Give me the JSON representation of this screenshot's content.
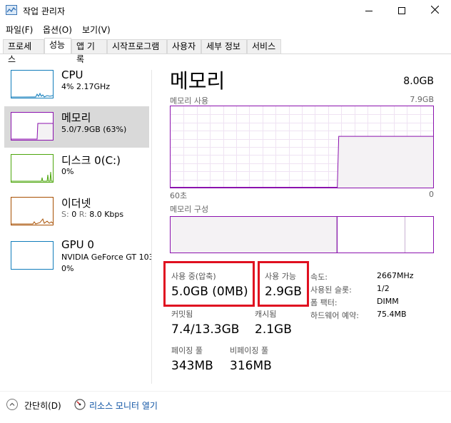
{
  "window": {
    "title": "작업 관리자",
    "minimize": "—",
    "maximize": "☐",
    "close": "✕"
  },
  "menu": [
    "파일(F)",
    "옵션(O)",
    "보기(V)"
  ],
  "tabs": [
    "프로세스",
    "성능",
    "앱 기록",
    "시작프로그램",
    "사용자",
    "세부 정보",
    "서비스"
  ],
  "active_tab": "성능",
  "sidebar": {
    "items": [
      {
        "title": "CPU",
        "subtitle": "4%  2.17GHz",
        "color": "#117dbb"
      },
      {
        "title": "메모리",
        "subtitle": "5.0/7.9GB (63%)",
        "color": "#8b12ae"
      },
      {
        "title": "디스크 0(C:)",
        "subtitle": "0%",
        "color": "#4da60c"
      },
      {
        "title": "이더넷",
        "subtitle_label_s": "S:",
        "subtitle_s": "0",
        "subtitle_label_r": "R:",
        "subtitle_r": "8.0 Kbps",
        "color": "#a74f01"
      },
      {
        "title": "GPU 0",
        "subtitle": "NVIDIA GeForce GT 103",
        "subtitle2": "0%",
        "color": "#117dbb"
      }
    ]
  },
  "main": {
    "title": "메모리",
    "total": "8.0GB",
    "usage_label": "메모리 사용",
    "usage_max": "7.9GB",
    "time_left": "60초",
    "time_right": "0",
    "composition_label": "메모리 구성",
    "usage_level_fraction": 0.63,
    "stats": {
      "in_use_label": "사용 중(압축)",
      "in_use_value": "5.0GB (0MB)",
      "available_label": "사용 가능",
      "available_value": "2.9GB",
      "committed_label": "커밋됨",
      "committed_value": "7.4/13.3GB",
      "cached_label": "캐시됨",
      "cached_value": "2.1GB",
      "paged_label": "페이징 풀",
      "paged_value": "343MB",
      "nonpaged_label": "비페이징 풀",
      "nonpaged_value": "316MB"
    },
    "props": [
      {
        "label": "속도:",
        "value": "2667MHz"
      },
      {
        "label": "사용된 슬롯:",
        "value": "1/2"
      },
      {
        "label": "폼 팩터:",
        "value": "DIMM"
      },
      {
        "label": "하드웨어 예약:",
        "value": "75.4MB"
      }
    ]
  },
  "footer": {
    "collapse": "간단히(D)",
    "resource_monitor": "리소스 모니터 열기"
  },
  "colors": {
    "memory": "#8b12ae",
    "highlight": "#e01020",
    "link": "#0c52a3"
  }
}
